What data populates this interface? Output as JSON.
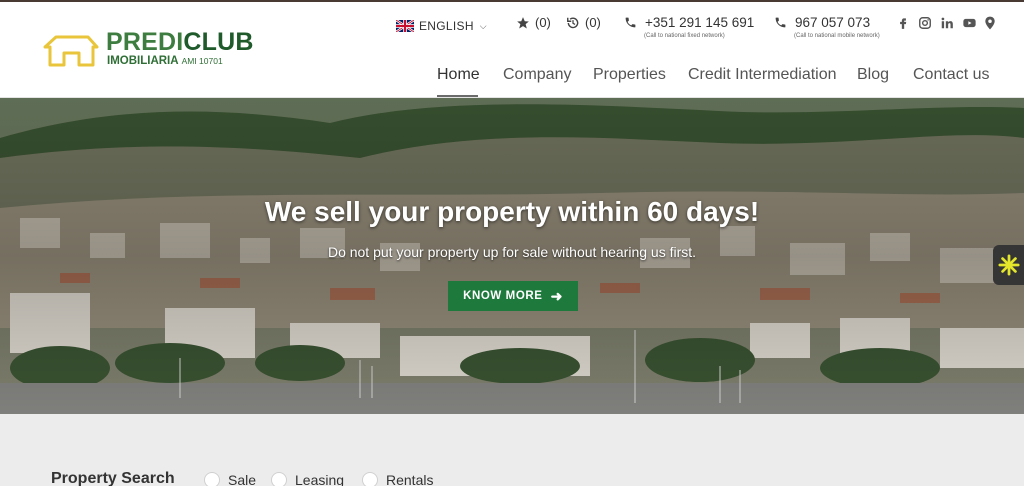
{
  "brand": {
    "name_part1": "PREDI",
    "name_part2": "CLUB",
    "subtitle": "IMOBILIARIA",
    "license": "AMI 10701",
    "colors": {
      "green": "#3d7d3f",
      "dark_green": "#1f5a2b",
      "house_yellow": "#e8c53a"
    }
  },
  "topbar": {
    "language": "ENGLISH",
    "favorites_count": "(0)",
    "history_count": "(0)",
    "phones": [
      {
        "number": "+351 291 145 691",
        "note": "(Call to national fixed network)"
      },
      {
        "number": "967 057 073",
        "note": "(Call to national mobile network)"
      }
    ],
    "socials": [
      "facebook-icon",
      "instagram-icon",
      "linkedin-icon",
      "youtube-icon",
      "location-pin-icon"
    ]
  },
  "nav": {
    "items": [
      {
        "label": "Home",
        "active": true
      },
      {
        "label": "Company",
        "active": false
      },
      {
        "label": "Properties",
        "active": false
      },
      {
        "label": "Credit Intermediation",
        "active": false
      },
      {
        "label": "Blog",
        "active": false
      },
      {
        "label": "Contact us",
        "active": false
      }
    ]
  },
  "hero": {
    "title": "We sell your property within 60 days!",
    "subtitle": "Do not put your property up for sale without hearing us first.",
    "button_label": "KNOW MORE",
    "button_color": "#1e7a3c"
  },
  "search": {
    "title": "Property Search",
    "options": [
      "Sale",
      "Leasing",
      "Rentals"
    ]
  }
}
